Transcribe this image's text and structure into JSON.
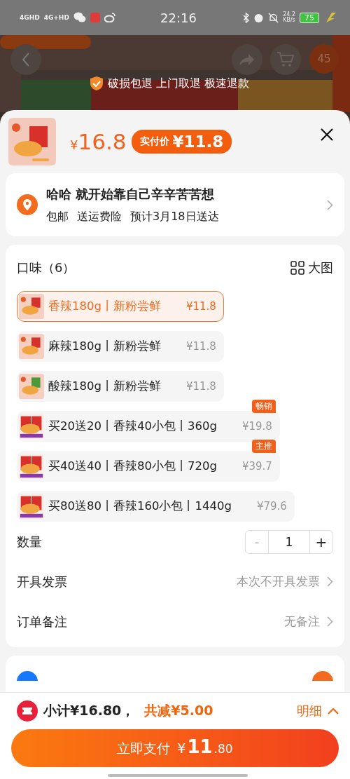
{
  "status_bar": {
    "networks": [
      "4GHD",
      "4G+HD"
    ],
    "time": "22:16",
    "speed": [
      "24.2",
      "KB/s"
    ],
    "battery": "75"
  },
  "background_page": {
    "cart_count": "45",
    "guarantee": "破损包退 上门取退 极速退款"
  },
  "header": {
    "price_symbol": "¥",
    "price": "16.8",
    "final_price_label": "实付价",
    "final_price": "¥11.8"
  },
  "address": {
    "name_line": "哈哈 就开始靠自己辛辛苦苦想",
    "info": [
      "包邮",
      "送运费险",
      "预计3月18日送达"
    ]
  },
  "options": {
    "title": "口味（6）",
    "view_toggle": "大图",
    "items": [
      {
        "label": "香辣180g丨新粉尝鲜",
        "price": "¥11.8",
        "selected": true,
        "kind": "single"
      },
      {
        "label": "麻辣180g丨新粉尝鲜",
        "price": "¥11.8",
        "selected": false,
        "kind": "single"
      },
      {
        "label": "酸辣180g丨新粉尝鲜",
        "price": "¥11.8",
        "selected": false,
        "kind": "single"
      },
      {
        "label": "买20送20丨香辣40小包丨360g",
        "price": "¥19.8",
        "selected": false,
        "kind": "bundle",
        "tag": "畅销"
      },
      {
        "label": "买40送40丨香辣80小包丨720g",
        "price": "¥39.7",
        "selected": false,
        "kind": "bundle",
        "tag": "主推"
      },
      {
        "label": "买80送80丨香辣160小包丨1440g",
        "price": "¥79.6",
        "selected": false,
        "kind": "bundle"
      }
    ]
  },
  "quantity": {
    "label": "数量",
    "minus": "-",
    "value": "1",
    "plus": "+",
    "minus_disabled": true
  },
  "settings": [
    {
      "label": "开具发票",
      "value": "本次不开具发票"
    },
    {
      "label": "订单备注",
      "value": "无备注"
    }
  ],
  "payment": {
    "selected": true
  },
  "bottom_bar": {
    "subtotal": "小计¥16.80，",
    "discount": "共减¥5.00",
    "details": "明细"
  },
  "pay_button": {
    "label": "立即支付",
    "currency": "¥",
    "amount_int": "11",
    "amount_dec": ".80"
  }
}
